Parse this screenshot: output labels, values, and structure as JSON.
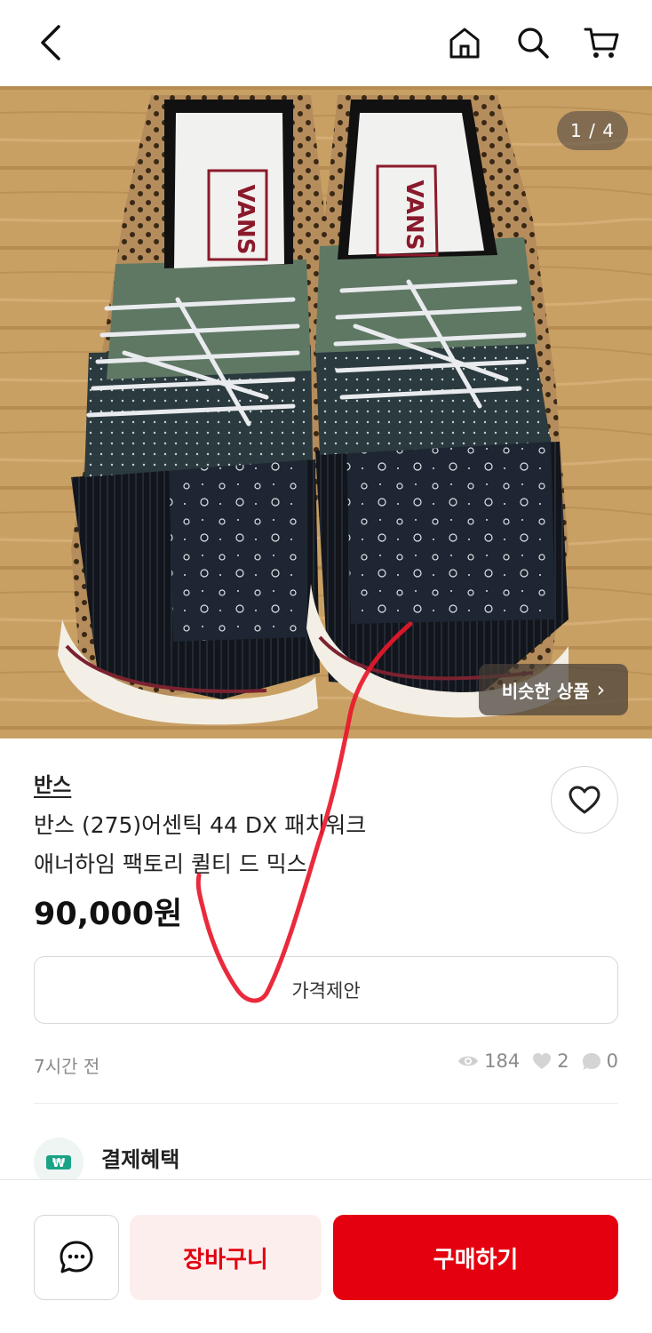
{
  "header": {
    "back_icon": "chevron-left-icon",
    "home_icon": "home-icon",
    "search_icon": "search-icon",
    "cart_icon": "cart-icon"
  },
  "gallery": {
    "counter": "1 / 4",
    "similar_label": "비슷한 상품",
    "similar_chevron": "›"
  },
  "product": {
    "brand": "반스",
    "title_line1": "반스 (275)어센틱 44 DX 패치워크",
    "title_line2": "애너하임 팩토리 퀼티 드 믹스",
    "price": "90,000원",
    "offer_label": "가격제안",
    "posted": "7시간 전",
    "views": "184",
    "likes": "2",
    "chats": "0"
  },
  "benefits": {
    "label": "결제혜택",
    "icon": "won-ticket-icon"
  },
  "actions": {
    "chat_icon": "chat-bubble-icon",
    "cart_label": "장바구니",
    "buy_label": "구매하기"
  },
  "colors": {
    "accent": "#e5000f",
    "cart_bg": "#fdeeee",
    "muted_text": "#8a8a8a"
  }
}
